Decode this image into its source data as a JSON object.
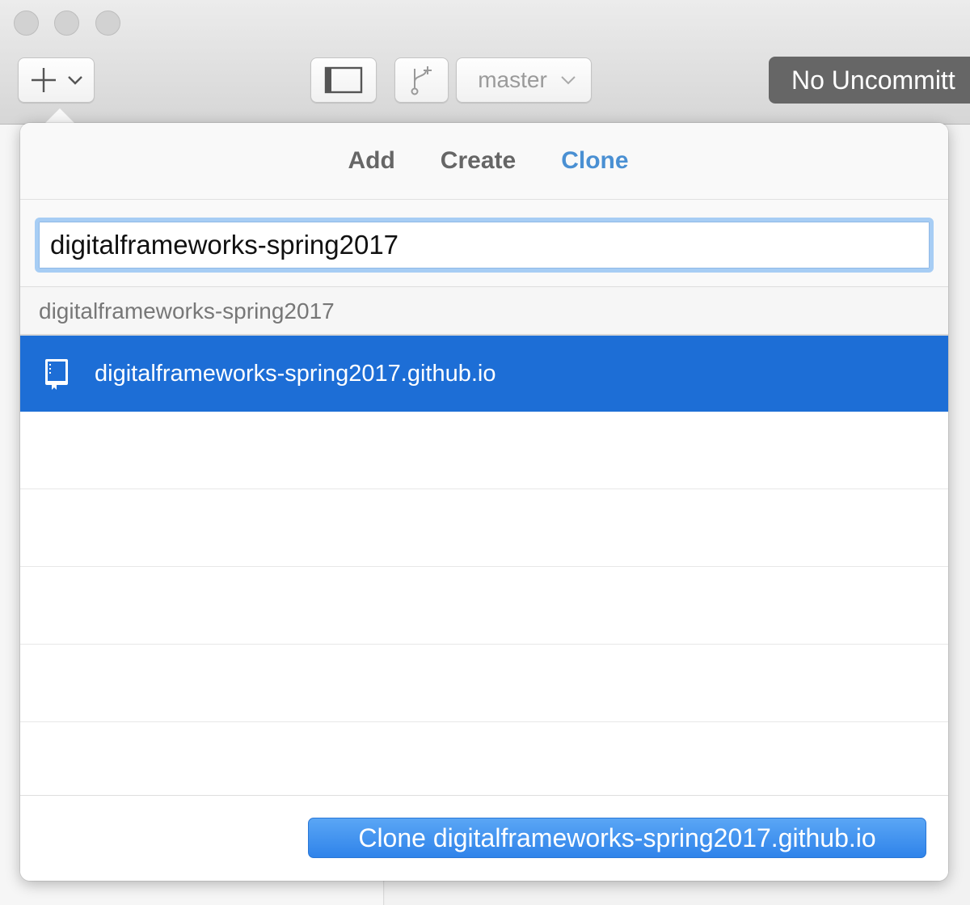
{
  "toolbar": {
    "branch_label": "master",
    "commit_label": "No Uncommitt"
  },
  "popover": {
    "tabs": [
      {
        "label": "Add",
        "active": false
      },
      {
        "label": "Create",
        "active": false
      },
      {
        "label": "Clone",
        "active": true
      }
    ],
    "search": {
      "value": "digitalframeworks-spring2017"
    },
    "group_header": "digitalframeworks-spring2017",
    "results": [
      {
        "name": "digitalframeworks-spring2017.github.io",
        "icon": "repo-icon",
        "selected": true
      }
    ],
    "clone_button_label": "Clone digitalframeworks-spring2017.github.io"
  },
  "colors": {
    "accent": "#4a90d3",
    "selection": "#1d6ed6",
    "clone_button": "#3c8eef"
  }
}
